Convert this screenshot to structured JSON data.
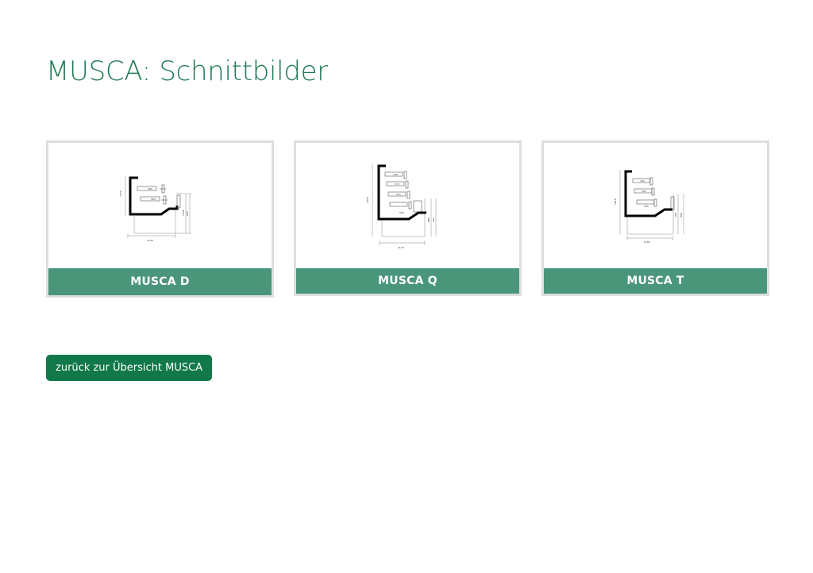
{
  "page": {
    "title": "MUSCA: Schnittbilder"
  },
  "cards": [
    {
      "label": "MUSCA D",
      "image_alt": "Schnittbild MUSCA D"
    },
    {
      "label": "MUSCA Q",
      "image_alt": "Schnittbild MUSCA Q"
    },
    {
      "label": "MUSCA T",
      "image_alt": "Schnittbild MUSCA T"
    }
  ],
  "back_button": {
    "label": "zurück zur Übersicht MUSCA"
  },
  "colors": {
    "title": "#1f7a52",
    "card_label_bg": "#4a967a",
    "card_border": "#dedede",
    "button_bg": "#11784a"
  }
}
